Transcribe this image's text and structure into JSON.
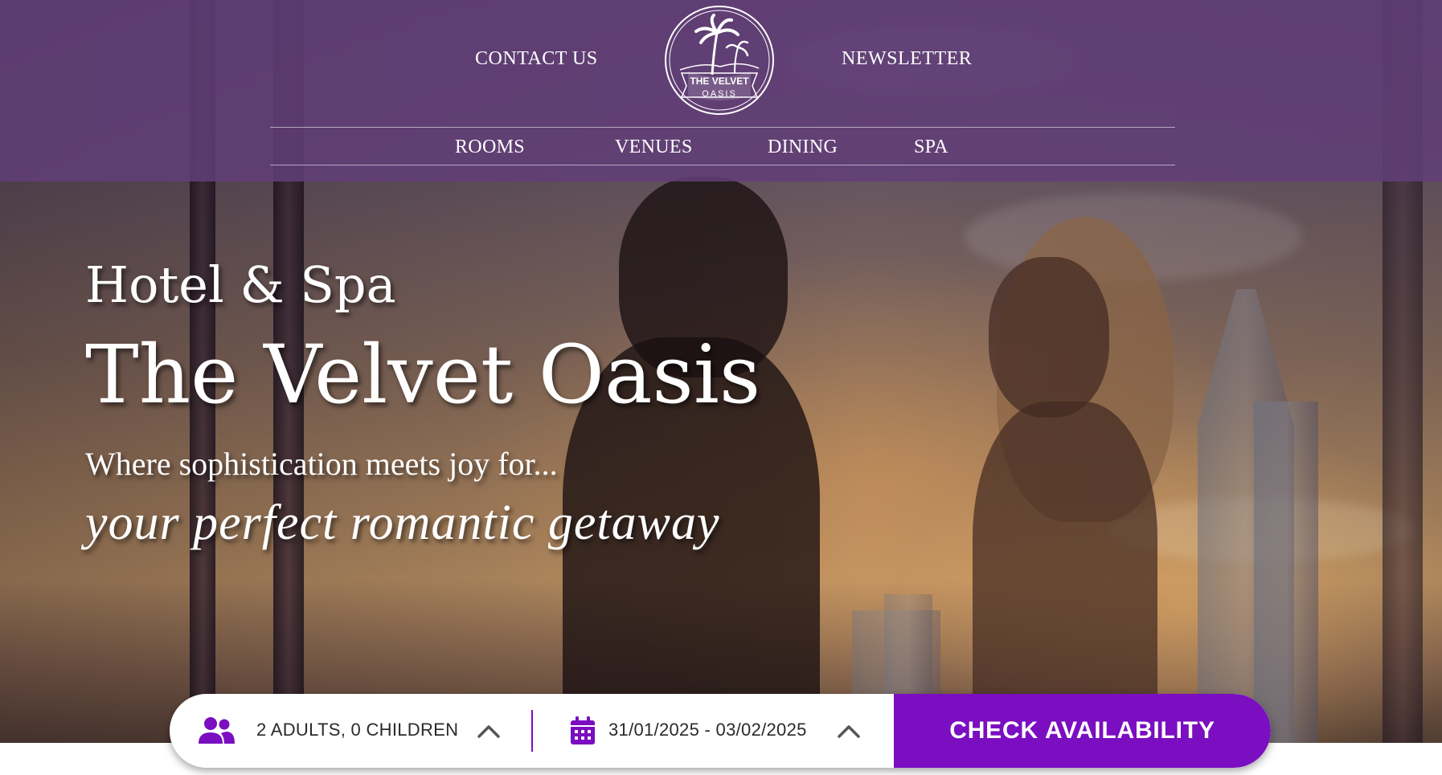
{
  "header": {
    "contact_label": "CONTACT US",
    "newsletter_label": "NEWSLETTER",
    "logo": {
      "line1": "THE VELVET",
      "line2": "OASIS"
    },
    "nav": [
      {
        "label": "ROOMS"
      },
      {
        "label": "VENUES"
      },
      {
        "label": "DINING"
      },
      {
        "label": "SPA"
      }
    ]
  },
  "hero": {
    "eyebrow": "Hotel & Spa",
    "title": "The Velvet Oasis",
    "tagline": "Where sophistication meets joy for...",
    "tagline_italic": "your perfect romantic getaway"
  },
  "booking": {
    "guests_icon": "people-icon",
    "guests_value": "2 ADULTS, 0 CHILDREN",
    "dates_icon": "calendar-icon",
    "dates_value": "31/01/2025 - 03/02/2025",
    "chevron_icon": "chevron-up-icon",
    "cta_label": "CHECK AVAILABILITY"
  },
  "colors": {
    "header_overlay": "#623e78",
    "accent_purple": "#7a0ec0",
    "text_white": "#ffffff"
  }
}
